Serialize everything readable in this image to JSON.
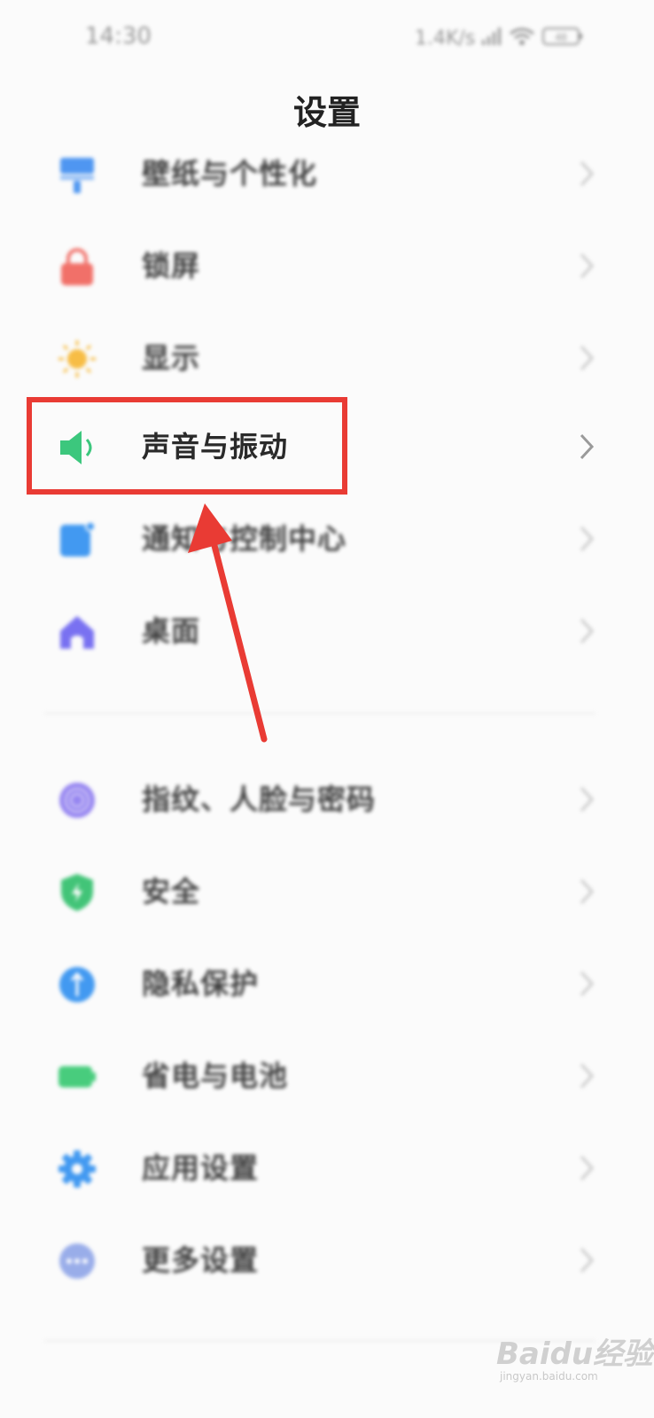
{
  "status_bar": {
    "time": "14:30",
    "network_speed": "1.4K/s",
    "battery": "48"
  },
  "header": {
    "title": "设置"
  },
  "settings": [
    {
      "label": "壁纸与个性化",
      "icon": "wallpaper-icon",
      "color": "#3d8cf0"
    },
    {
      "label": "锁屏",
      "icon": "lock-icon",
      "color": "#f0625a"
    },
    {
      "label": "显示",
      "icon": "sun-icon",
      "color": "#f7b733"
    },
    {
      "label": "声音与振动",
      "icon": "speaker-icon",
      "color": "#3cc77d"
    },
    {
      "label": "通知与控制中心",
      "icon": "notification-icon",
      "color": "#2f8ff0"
    },
    {
      "label": "桌面",
      "icon": "home-icon",
      "color": "#6b63f0"
    },
    {
      "label": "指纹、人脸与密码",
      "icon": "fingerprint-icon",
      "color": "#8c7af0"
    },
    {
      "label": "安全",
      "icon": "shield-icon",
      "color": "#2fbf6a"
    },
    {
      "label": "隐私保护",
      "icon": "privacy-icon",
      "color": "#2f8ff0"
    },
    {
      "label": "省电与电池",
      "icon": "battery-icon",
      "color": "#35c870"
    },
    {
      "label": "应用设置",
      "icon": "gear-icon",
      "color": "#2f8ff0"
    },
    {
      "label": "更多设置",
      "icon": "more-icon",
      "color": "#8fa5e8"
    }
  ],
  "annotation": {
    "highlight_color": "#e93b34"
  },
  "watermark": {
    "brand": "Baidu经验",
    "site": "jingyan.baidu.com"
  }
}
